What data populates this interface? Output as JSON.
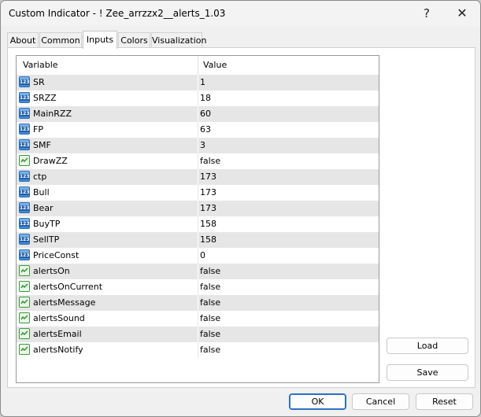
{
  "window": {
    "title": "Custom Indicator - ! Zee_arrzzx2__alerts_1.03",
    "help_glyph": "?",
    "close_glyph": "✕"
  },
  "tabs": [
    {
      "label": "About"
    },
    {
      "label": "Common"
    },
    {
      "label": "Inputs"
    },
    {
      "label": "Colors"
    },
    {
      "label": "Visualization"
    }
  ],
  "active_tab": "Inputs",
  "grid": {
    "headers": {
      "variable": "Variable",
      "value": "Value"
    },
    "icon_text": "123",
    "rows": [
      {
        "name": "SR",
        "value": "1",
        "icon": "number-icon"
      },
      {
        "name": "SRZZ",
        "value": "18",
        "icon": "number-icon"
      },
      {
        "name": "MainRZZ",
        "value": "60",
        "icon": "number-icon"
      },
      {
        "name": "FP",
        "value": "63",
        "icon": "number-icon"
      },
      {
        "name": "SMF",
        "value": "3",
        "icon": "number-icon"
      },
      {
        "name": "DrawZZ",
        "value": "false",
        "icon": "boolean-icon"
      },
      {
        "name": "ctp",
        "value": "173",
        "icon": "number-icon"
      },
      {
        "name": "Bull",
        "value": "173",
        "icon": "number-icon"
      },
      {
        "name": "Bear",
        "value": "173",
        "icon": "number-icon"
      },
      {
        "name": "BuyTP",
        "value": "158",
        "icon": "number-icon"
      },
      {
        "name": "SellTP",
        "value": "158",
        "icon": "number-icon"
      },
      {
        "name": "PriceConst",
        "value": "0",
        "icon": "number-icon"
      },
      {
        "name": "alertsOn",
        "value": "false",
        "icon": "boolean-icon"
      },
      {
        "name": "alertsOnCurrent",
        "value": "false",
        "icon": "boolean-icon"
      },
      {
        "name": "alertsMessage",
        "value": "false",
        "icon": "boolean-icon"
      },
      {
        "name": "alertsSound",
        "value": "false",
        "icon": "boolean-icon"
      },
      {
        "name": "alertsEmail",
        "value": "false",
        "icon": "boolean-icon"
      },
      {
        "name": "alertsNotify",
        "value": "false",
        "icon": "boolean-icon"
      }
    ]
  },
  "side_buttons": {
    "load": "Load",
    "save": "Save"
  },
  "footer_buttons": {
    "ok": "OK",
    "cancel": "Cancel",
    "reset": "Reset"
  },
  "colors": {
    "accent": "#2b6fc4",
    "alt_row": "#e6e6e6",
    "window_bg": "#f0f0f0"
  }
}
